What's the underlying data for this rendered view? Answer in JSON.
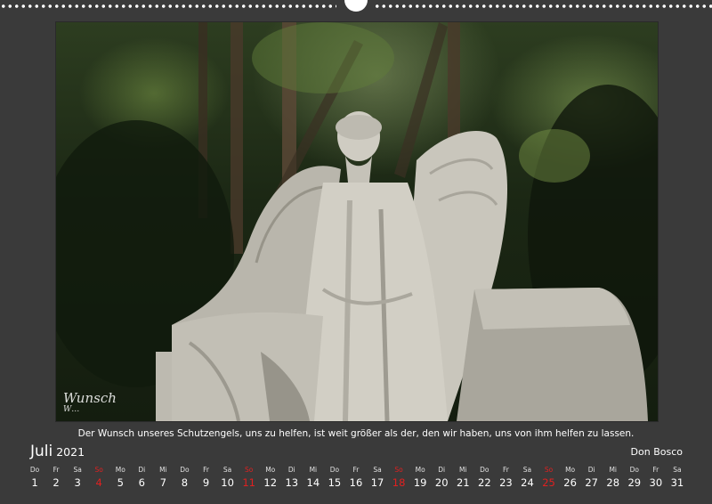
{
  "photo": {
    "description_icon": "angel-statue-photo",
    "watermark_line1": "Wunsch",
    "watermark_line2": "W…"
  },
  "quote": "Der Wunsch unseres Schutzengels, uns zu helfen, ist weit größer als der, den wir haben, uns von ihm helfen zu lassen.",
  "month": "Juli",
  "year": "2021",
  "author": "Don Bosco",
  "colors": {
    "background": "#3a3a3a",
    "sunday": "#e02020",
    "text": "#ffffff"
  },
  "days": [
    {
      "dow": "Do",
      "num": "1"
    },
    {
      "dow": "Fr",
      "num": "2"
    },
    {
      "dow": "Sa",
      "num": "3"
    },
    {
      "dow": "So",
      "num": "4"
    },
    {
      "dow": "Mo",
      "num": "5"
    },
    {
      "dow": "Di",
      "num": "6"
    },
    {
      "dow": "Mi",
      "num": "7"
    },
    {
      "dow": "Do",
      "num": "8"
    },
    {
      "dow": "Fr",
      "num": "9"
    },
    {
      "dow": "Sa",
      "num": "10"
    },
    {
      "dow": "So",
      "num": "11"
    },
    {
      "dow": "Mo",
      "num": "12"
    },
    {
      "dow": "Di",
      "num": "13"
    },
    {
      "dow": "Mi",
      "num": "14"
    },
    {
      "dow": "Do",
      "num": "15"
    },
    {
      "dow": "Fr",
      "num": "16"
    },
    {
      "dow": "Sa",
      "num": "17"
    },
    {
      "dow": "So",
      "num": "18"
    },
    {
      "dow": "Mo",
      "num": "19"
    },
    {
      "dow": "Di",
      "num": "20"
    },
    {
      "dow": "Mi",
      "num": "21"
    },
    {
      "dow": "Do",
      "num": "22"
    },
    {
      "dow": "Fr",
      "num": "23"
    },
    {
      "dow": "Sa",
      "num": "24"
    },
    {
      "dow": "So",
      "num": "25"
    },
    {
      "dow": "Mo",
      "num": "26"
    },
    {
      "dow": "Di",
      "num": "27"
    },
    {
      "dow": "Mi",
      "num": "28"
    },
    {
      "dow": "Do",
      "num": "29"
    },
    {
      "dow": "Fr",
      "num": "30"
    },
    {
      "dow": "Sa",
      "num": "31"
    }
  ]
}
